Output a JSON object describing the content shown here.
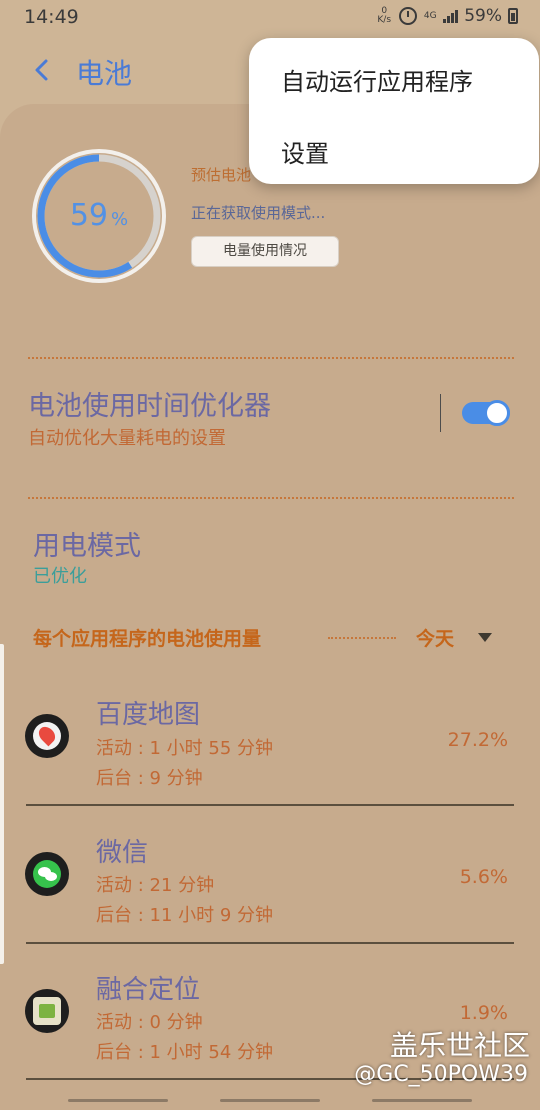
{
  "status_bar": {
    "time": "14:49",
    "net_speed_value": "0",
    "net_speed_unit": "K/s",
    "network_type": "4G",
    "battery": "59%"
  },
  "header": {
    "title": "电池"
  },
  "battery_summary": {
    "percent": "59",
    "percent_unit": "%",
    "percent_fill": 0.59,
    "estimate_label": "预估电池",
    "status": "正在获取使用模式...",
    "usage_button": "电量使用情况"
  },
  "optimizer": {
    "title": "电池使用时间优化器",
    "subtitle": "自动优化大量耗电的设置",
    "enabled": true
  },
  "power_mode": {
    "title": "用电模式",
    "value": "已优化"
  },
  "app_usage": {
    "section_title": "每个应用程序的电池使用量",
    "period": "今天",
    "items": [
      {
        "name": "百度地图",
        "active": "活动 : 1 小时 55 分钟",
        "background": "后台 : 9 分钟",
        "percent": "27.2%",
        "icon": "baidu-map-icon",
        "color": "#e94a3f"
      },
      {
        "name": "微信",
        "active": "活动 : 21 分钟",
        "background": "后台 : 11 小时 9 分钟",
        "percent": "5.6%",
        "icon": "wechat-icon",
        "color": "#36c24c"
      },
      {
        "name": "融合定位",
        "active": "活动 : 0 分钟",
        "background": "后台 : 1 小时 54 分钟",
        "percent": "1.9%",
        "icon": "android-icon",
        "color": "#7cb342"
      }
    ]
  },
  "popup_menu": {
    "items": [
      "自动运行应用程序",
      "设置"
    ]
  },
  "watermark": {
    "title": "盖乐世社区",
    "user": "@GC_50POW39"
  }
}
